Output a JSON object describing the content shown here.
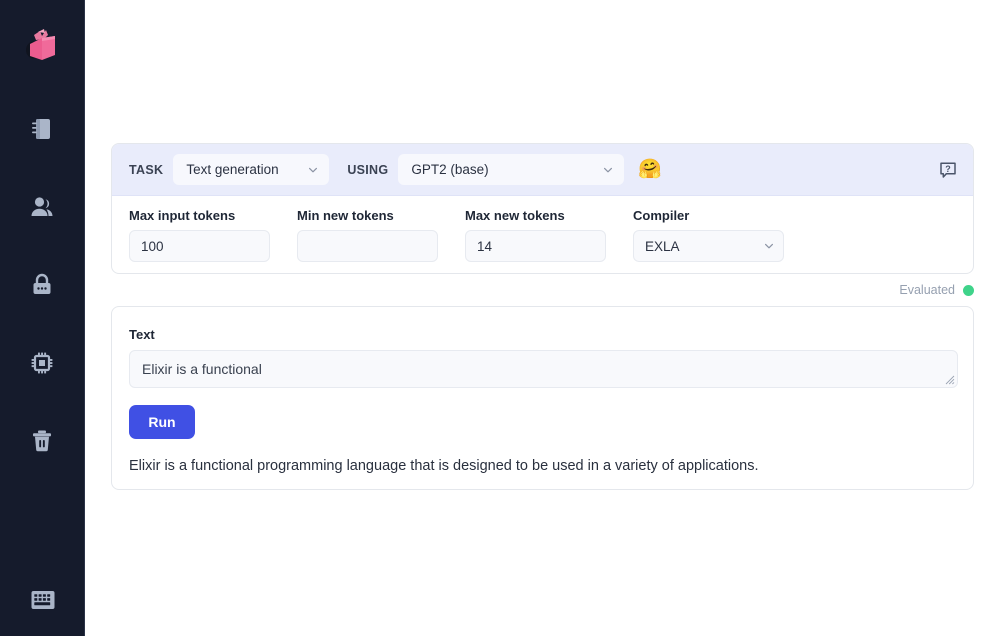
{
  "sidebar": {
    "logo": {
      "name": "livebook-logo",
      "alt": "Livebook"
    },
    "items": [
      {
        "icon": "notebook-icon",
        "label": "Notebook"
      },
      {
        "icon": "users-icon",
        "label": "Connected users"
      },
      {
        "icon": "lock-icon",
        "label": "Secrets"
      },
      {
        "icon": "cpu-chip-icon",
        "label": "Runtime settings"
      },
      {
        "icon": "trash-icon",
        "label": "Bin"
      }
    ],
    "bottom": {
      "icon": "keyboard-icon",
      "label": "Keyboard shortcuts"
    }
  },
  "neural_hub": {
    "task_label": "TASK",
    "task_value": "Text generation",
    "using_label": "USING",
    "using_value": "GPT2 (base)",
    "hf_emoji": "🤗",
    "help_icon": "help-question-icon",
    "params": [
      {
        "label": "Max input tokens",
        "value": "100",
        "type": "number"
      },
      {
        "label": "Min new tokens",
        "value": "",
        "type": "number"
      },
      {
        "label": "Max new tokens",
        "value": "14",
        "type": "number"
      },
      {
        "label": "Compiler",
        "value": "EXLA",
        "type": "select"
      }
    ]
  },
  "status": {
    "text": "Evaluated",
    "dot_color": "#3fd38a"
  },
  "output_card": {
    "text_label": "Text",
    "input_value": "Elixir is a functional",
    "run_label": "Run",
    "result_text": "Elixir is a functional programming language that is designed to be used in a variety of applications."
  },
  "colors": {
    "sidebar_bg": "#151b2c",
    "header_bg": "#e9ecfb",
    "accent_blue": "#4050e4",
    "status_green": "#3fd38a",
    "logo_pink": "#ef5a8c"
  }
}
